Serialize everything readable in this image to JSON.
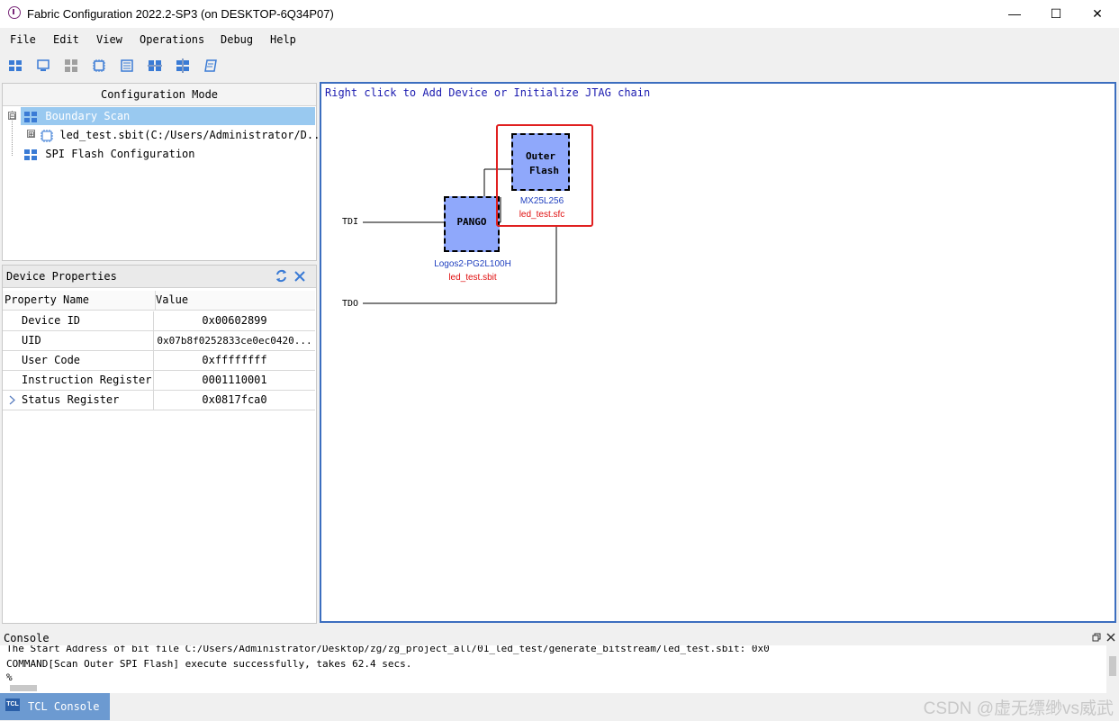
{
  "window": {
    "title": "Fabric Configuration 2022.2-SP3 (on DESKTOP-6Q34P07)",
    "minimize": "—",
    "maximize": "☐",
    "close": "✕"
  },
  "menu": [
    "File",
    "Edit",
    "View",
    "Operations",
    "Debug",
    "Help"
  ],
  "toolbar": {
    "icons": [
      "boundary-scan-icon",
      "monitor-icon",
      "grid-icon",
      "chip-icon",
      "list-icon",
      "chain-icon",
      "chain-alt-icon",
      "script-icon"
    ]
  },
  "config_panel": {
    "header": "Configuration Mode",
    "items": [
      {
        "label": "Boundary Scan",
        "expander": "⊟"
      },
      {
        "label": "led_test.sbit(C:/Users/Administrator/D...",
        "expander": "⊞"
      },
      {
        "label": "SPI Flash Configuration"
      }
    ]
  },
  "device_properties": {
    "header": "Device Properties",
    "columns": [
      "Property Name",
      "Value"
    ],
    "rows": [
      {
        "name": "Device ID",
        "value": "0x00602899"
      },
      {
        "name": "UID",
        "value": "0x07b8f0252833ce0ec0420..."
      },
      {
        "name": "User Code",
        "value": "0xffffffff"
      },
      {
        "name": "Instruction Register",
        "value": "0001110001"
      },
      {
        "name": "Status Register",
        "value": "0x0817fca0"
      }
    ],
    "refresh_icon": "refresh-icon",
    "close_icon": "close-icon"
  },
  "canvas": {
    "hint": "Right click to Add Device or Initialize JTAG chain",
    "tdi": "TDI",
    "tdo": "TDO",
    "pango": {
      "chip_label": "PANGO",
      "part": "Logos2-PG2L100H",
      "file": "led_test.sbit"
    },
    "flash": {
      "chip_label_line1": "Outer",
      "chip_label_line2": "Flash",
      "part": "MX25L256",
      "file": "led_test.sfc"
    },
    "colors": {
      "chip_fill": "#8fa8fb",
      "part_text": "#1f3fbf",
      "file_text": "#e01010",
      "highlight": "#e02020"
    }
  },
  "console": {
    "title": "Console",
    "lines": [
      "The Start Address of bit file C:/Users/Administrator/Desktop/zg/zg_project_all/01_led_test/generate_bitstream/led_test.sbit: 0x0",
      "COMMAND[Scan Outer SPI Flash] execute successfully, takes 62.4 secs.",
      "%"
    ],
    "restore_icon": "restore-icon",
    "close_icon": "close-icon"
  },
  "bottom": {
    "tab_icon_text": "TCL",
    "tab_label": "TCL Console",
    "watermark": "CSDN @虚无缥缈vs威武"
  }
}
